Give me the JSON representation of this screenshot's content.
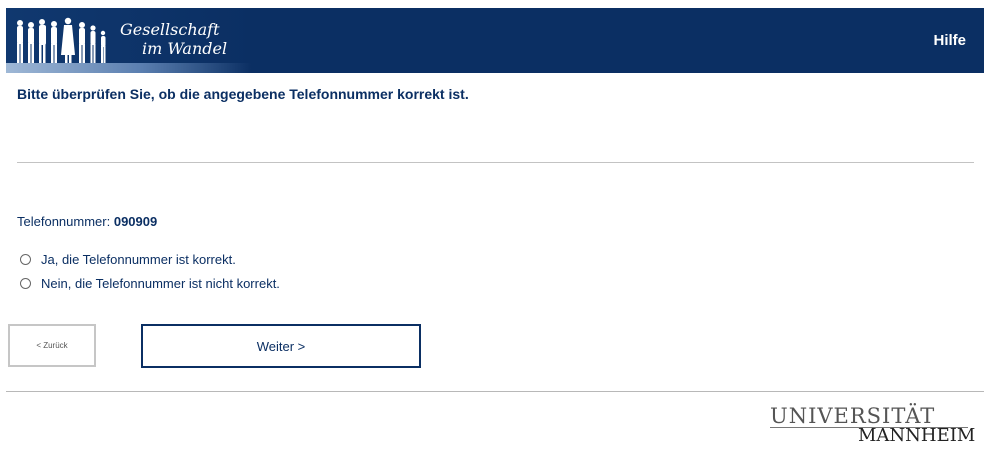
{
  "header": {
    "logo_line1": "Gesellschaft",
    "logo_line2": "im Wandel",
    "help_label": "Hilfe",
    "color": "#0b2f63"
  },
  "question": {
    "text": "Bitte überprüfen Sie, ob die angegebene Telefonnummer korrekt ist."
  },
  "phone": {
    "label": "Telefonnummer:",
    "value": "090909"
  },
  "options": [
    {
      "label": "Ja, die Telefonnummer ist korrekt.",
      "selected": false
    },
    {
      "label": "Nein, die Telefonnummer ist nicht korrekt.",
      "selected": false
    }
  ],
  "nav": {
    "back_label": "< Zurück",
    "next_label": "Weiter >"
  },
  "footer": {
    "logo_line1": "UNIVERSITÄT",
    "logo_line2": "MANNHEIM"
  }
}
